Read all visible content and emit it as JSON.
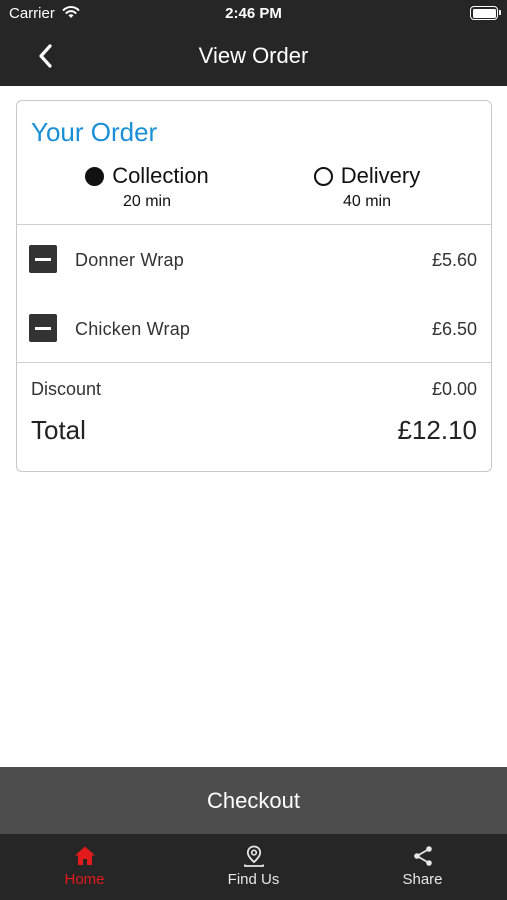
{
  "status_bar": {
    "carrier": "Carrier",
    "time": "2:46 PM"
  },
  "nav": {
    "title": "View Order",
    "back_icon": "chevron-left-icon"
  },
  "order": {
    "title": "Your Order",
    "options": [
      {
        "label": "Collection",
        "time": "20 min",
        "selected": true
      },
      {
        "label": "Delivery",
        "time": "40 min",
        "selected": false
      }
    ],
    "items": [
      {
        "name": "Donner Wrap",
        "price": "£5.60"
      },
      {
        "name": "Chicken Wrap",
        "price": "£6.50"
      }
    ],
    "discount_label": "Discount",
    "discount_value": "£0.00",
    "total_label": "Total",
    "total_value": "£12.10"
  },
  "checkout_label": "Checkout",
  "tabs": [
    {
      "label": "Home",
      "icon": "home-icon",
      "active": true
    },
    {
      "label": "Find Us",
      "icon": "map-pin-icon",
      "active": false
    },
    {
      "label": "Share",
      "icon": "share-icon",
      "active": false
    }
  ],
  "colors": {
    "accent": "#1a8fd6",
    "active_tab": "#e21a1a",
    "bar": "#262626",
    "checkout": "#4d4d4d"
  }
}
